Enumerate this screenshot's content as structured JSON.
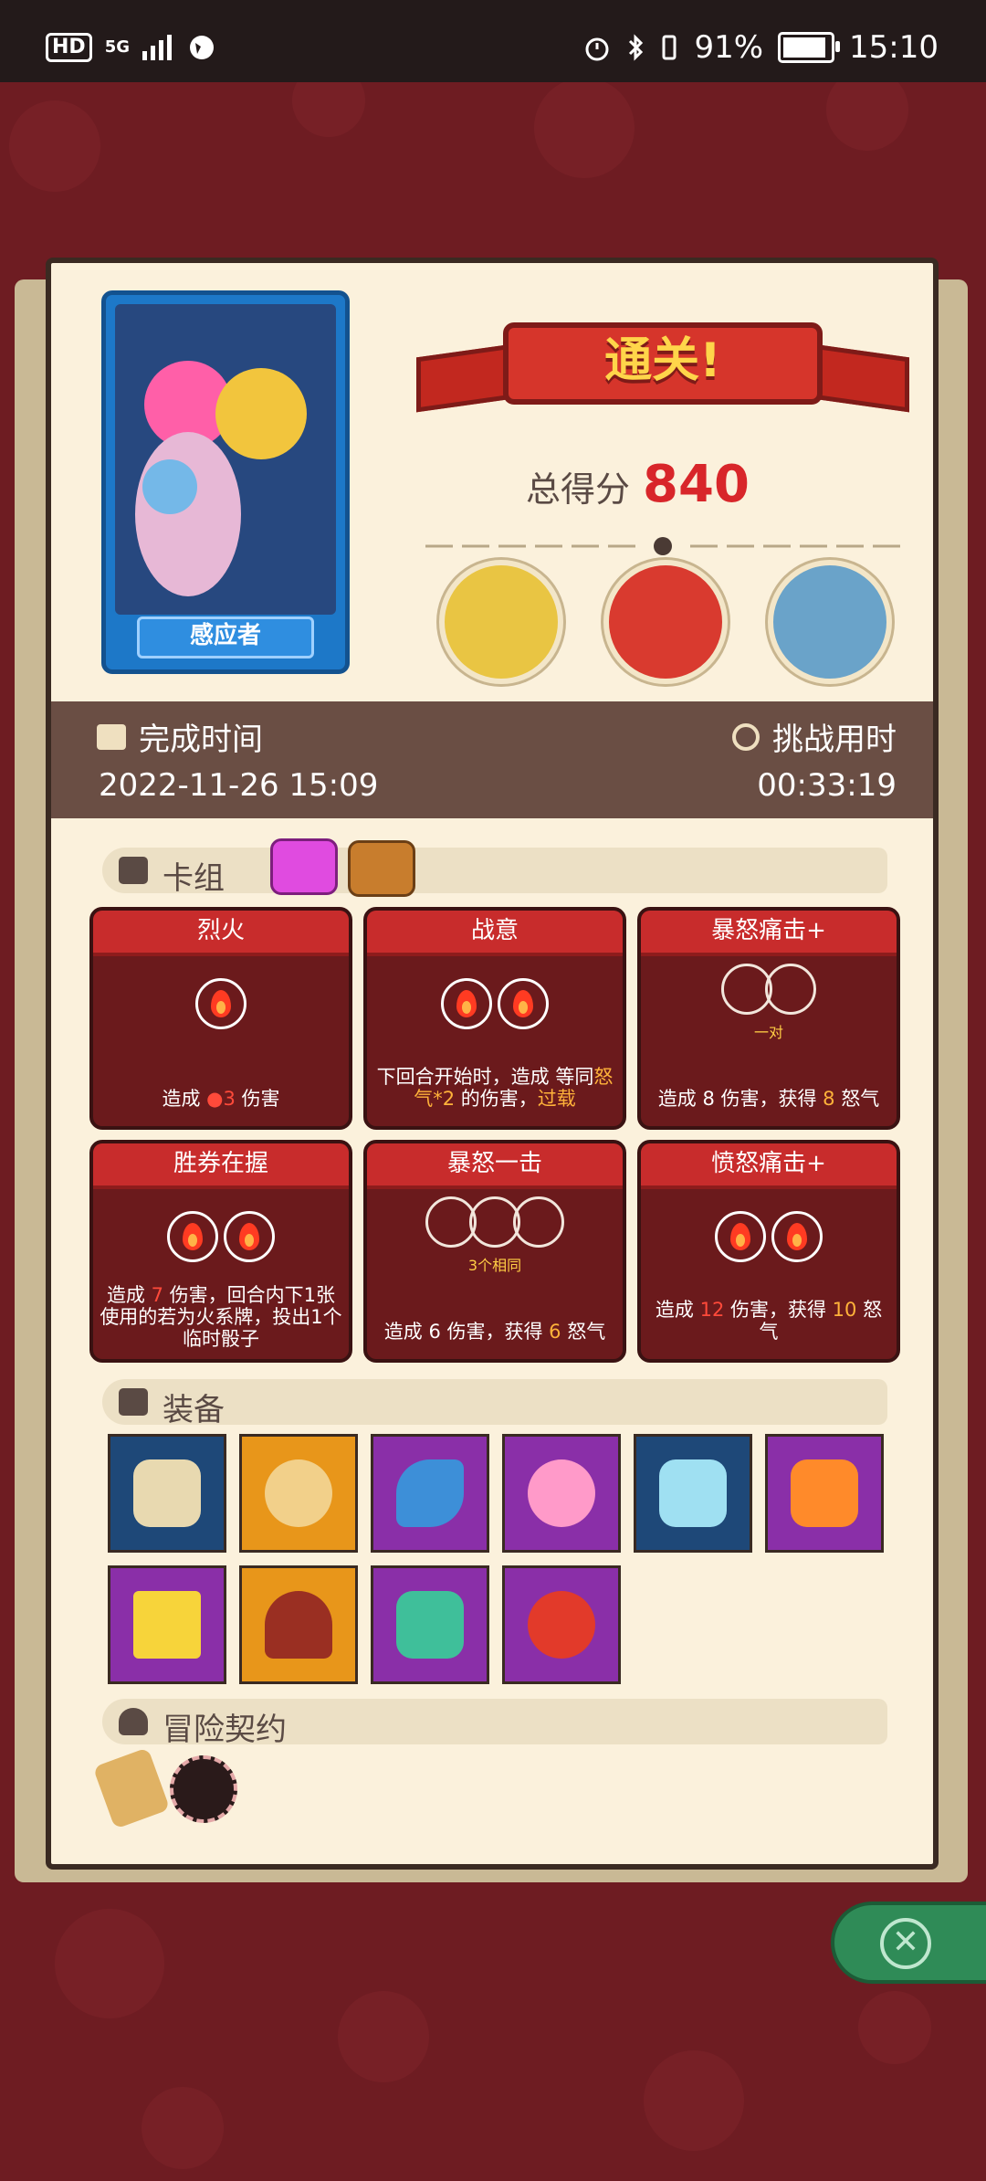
{
  "status_bar": {
    "network": "HD",
    "signal": "5G",
    "battery_percent": "91%",
    "time": "15:10",
    "battery_level": 0.91
  },
  "hero": {
    "name": "感应者"
  },
  "result": {
    "title": "通关!",
    "score_label": "总得分",
    "score": "840"
  },
  "time_info": {
    "finish_label": "完成时间",
    "finish_value": "2022-11-26 15:09",
    "duration_label": "挑战用时",
    "duration_value": "00:33:19"
  },
  "deck": {
    "label": "卡组",
    "cards": [
      {
        "title": "烈火",
        "slots": 1,
        "desc_a": "造成 ",
        "desc_b": "3",
        "desc_c": " 伤害"
      },
      {
        "title": "战意",
        "slots": 2,
        "desc_a": "下回合开始时，造成 等同",
        "desc_b": "怒气*2",
        "desc_c": " 的伤害，",
        "desc_d": "过载"
      },
      {
        "title": "暴怒痛击+",
        "slots": 2,
        "empty": true,
        "sub": "一对",
        "desc_a": "造成 ",
        "desc_b": "8",
        "desc_c": " 伤害，获得 ",
        "desc_d": "8",
        "desc_e": " 怒气"
      },
      {
        "title": "胜券在握",
        "slots": 2,
        "desc_a": "造成 ",
        "desc_b": "7",
        "desc_c": " 伤害，回合内下1张使用的若为",
        "desc_d": "火系牌，投出1个临时骰子"
      },
      {
        "title": "暴怒一击",
        "slots": 3,
        "empty": true,
        "sub": "3个相同",
        "desc_a": "造成 ",
        "desc_b": "6",
        "desc_c": " 伤害，获得 ",
        "desc_d": "6",
        "desc_e": " 怒气"
      },
      {
        "title": "愤怒痛击+",
        "slots": 2,
        "desc_a": "造成 ",
        "desc_b": "12",
        "desc_c": " 伤害，获得 ",
        "desc_d": "10",
        "desc_e": " 怒气"
      }
    ]
  },
  "equipment": {
    "label": "装备",
    "items": [
      {
        "icon": "snowflake-scroll-icon",
        "color": "blue"
      },
      {
        "icon": "coin-bag-icon",
        "color": "orange"
      },
      {
        "icon": "crescent-horn-icon",
        "color": "purple"
      },
      {
        "icon": "rainbow-orb-icon",
        "color": "purple"
      },
      {
        "icon": "crystal-gem-icon",
        "color": "blue"
      },
      {
        "icon": "fire-gem-icon",
        "color": "purple"
      },
      {
        "icon": "gold-brick-icon",
        "color": "purple"
      },
      {
        "icon": "hood-cloak-icon",
        "color": "orange"
      },
      {
        "icon": "demon-mask-icon",
        "color": "purple"
      },
      {
        "icon": "flame-dagger-icon",
        "color": "purple"
      }
    ]
  },
  "contract": {
    "label": "冒险契约"
  }
}
